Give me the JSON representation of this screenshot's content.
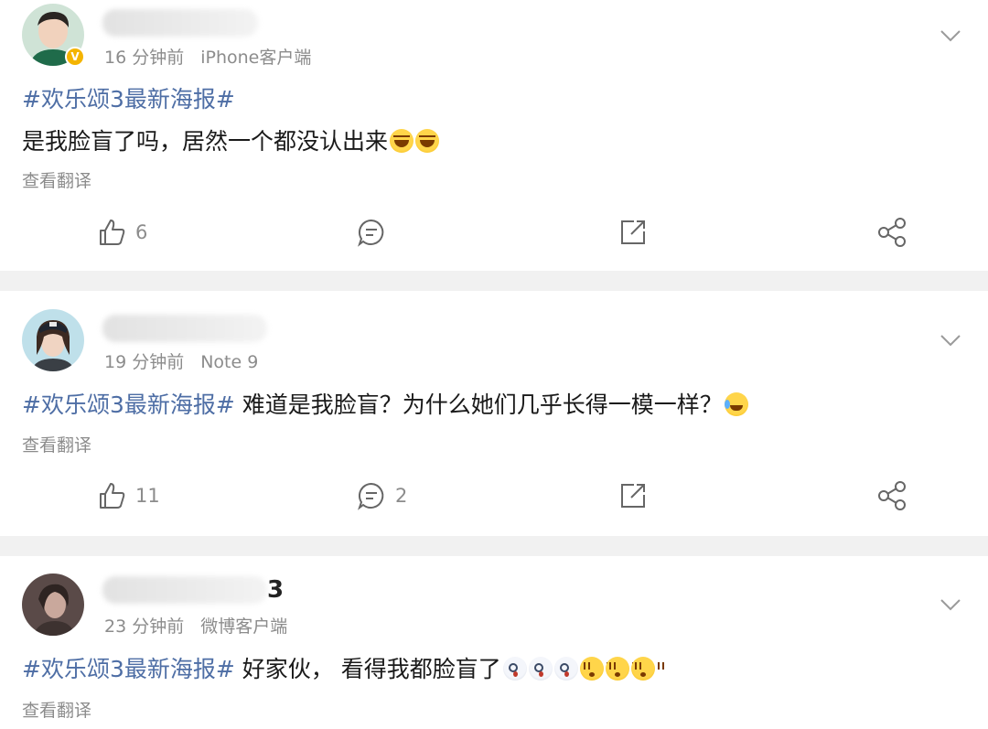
{
  "posts": [
    {
      "time": "16 分钟前",
      "source": "iPhone客户端",
      "hashtag": "#欢乐颂3最新海报#",
      "text": "是我脸盲了吗，居然一个都没认出来",
      "translate": "查看翻译",
      "likes": "6",
      "comments": "",
      "verified": "V"
    },
    {
      "time": "19 分钟前",
      "source": "Note 9",
      "hashtag": "#欢乐颂3最新海报#",
      "text": "难道是我脸盲？为什么她们几乎长得一模一样？",
      "translate": "查看翻译",
      "likes": "11",
      "comments": "2"
    },
    {
      "time": "23 分钟前",
      "source": "微博客户端",
      "hashtag": "#欢乐颂3最新海报#",
      "text": "好家伙， 看得我都脸盲了",
      "translate": "查看翻译",
      "name_visible_suffix": "3"
    }
  ],
  "icons": [
    "like-icon",
    "comment-icon",
    "repost-icon",
    "share-icon",
    "chevron-down-icon"
  ],
  "colors": {
    "hashtag": "#4e6ea5",
    "meta": "#8c8c8c",
    "divider": "#f1f1f1",
    "badge": "#f4b400"
  }
}
